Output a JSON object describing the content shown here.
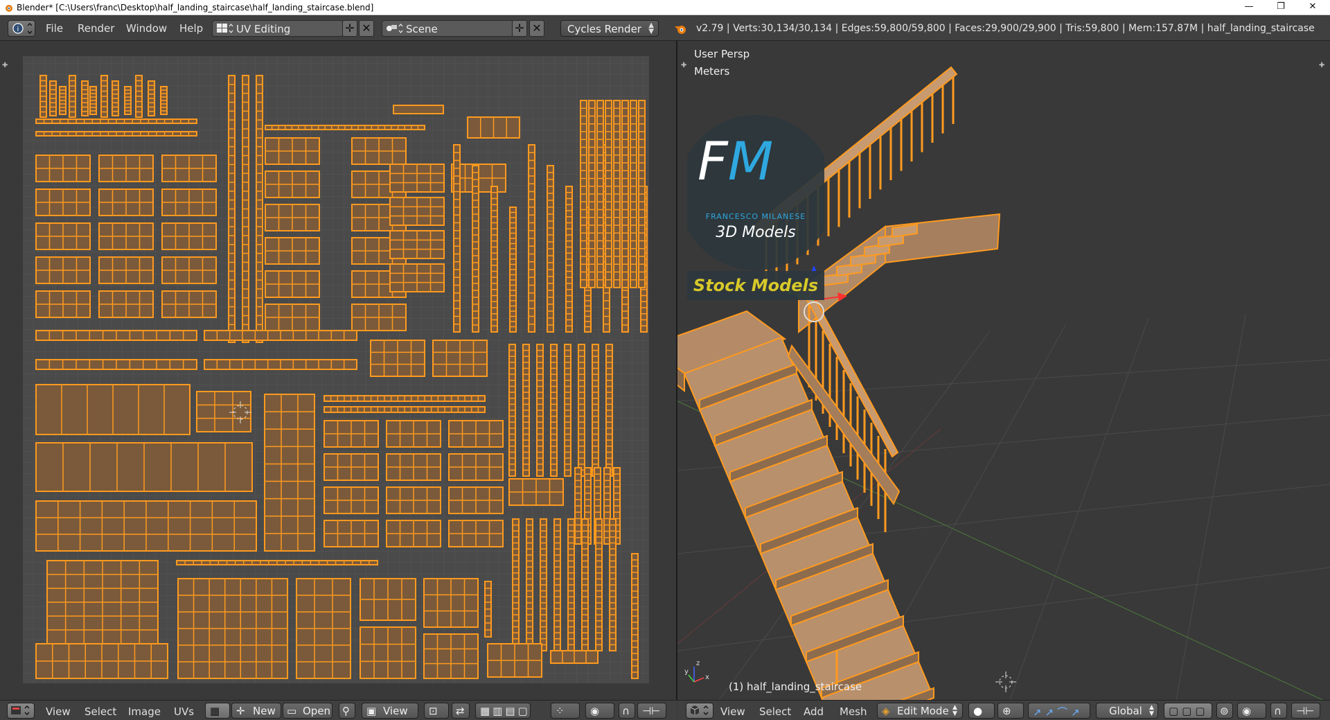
{
  "window": {
    "title": "Blender* [C:\\Users\\franc\\Desktop\\half_landing_staircase\\half_landing_staircase.blend]",
    "minimize": "—",
    "maximize": "❐",
    "close": "✕"
  },
  "info_header": {
    "menus": [
      "File",
      "Render",
      "Window",
      "Help"
    ],
    "layout_field": "UV Editing",
    "scene_field": "Scene",
    "engine": "Cycles Render",
    "stats": "v2.79 | Verts:30,134/30,134 | Edges:59,800/59,800 | Faces:29,900/29,900 | Tris:59,800 | Mem:157.87M | half_landing_staircase"
  },
  "viewport": {
    "view_name": "User Persp",
    "units": "Meters",
    "object_label": "(1) half_landing_staircase",
    "logo": {
      "initials": "FM",
      "name": "FRANCESCO MILANESE",
      "subtitle": "3D Models",
      "banner": "Stock Models"
    }
  },
  "uv_footer": {
    "menus": [
      "View",
      "Select",
      "Image",
      "UVs"
    ],
    "new_label": "New",
    "open_label": "Open",
    "view_label": "View"
  },
  "view3d_footer": {
    "menus": [
      "View",
      "Select",
      "Add",
      "Mesh"
    ],
    "mode": "Edit Mode",
    "orientation": "Global"
  },
  "colors": {
    "accent": "#ff9a1f",
    "uv_fill": "#7a5a3a",
    "background": "#393939",
    "logo_blue": "#2fa8e0",
    "logo_yellow": "#d8c92a"
  }
}
